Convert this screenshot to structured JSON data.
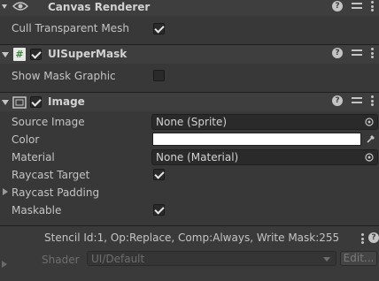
{
  "canvas_renderer": {
    "title": "Canvas Renderer",
    "cull_label": "Cull Transparent Mesh",
    "cull_checked": true
  },
  "ui_super_mask": {
    "title": "UISuperMask",
    "enabled": true,
    "show_mask_label": "Show Mask Graphic",
    "show_mask_checked": false
  },
  "image": {
    "title": "Image",
    "enabled": true,
    "source_image_label": "Source Image",
    "source_image_value": "None (Sprite)",
    "color_label": "Color",
    "color_value": "#ffffff",
    "material_label": "Material",
    "material_value": "None (Material)",
    "raycast_target_label": "Raycast Target",
    "raycast_target_checked": true,
    "raycast_padding_label": "Raycast Padding",
    "maskable_label": "Maskable",
    "maskable_checked": true
  },
  "material_preview": {
    "stencil_text": "Stencil Id:1, Op:Replace, Comp:Always, Write Mask:255",
    "shader_label": "Shader",
    "shader_value": "UI/Default",
    "edit_label": "Edit..."
  }
}
